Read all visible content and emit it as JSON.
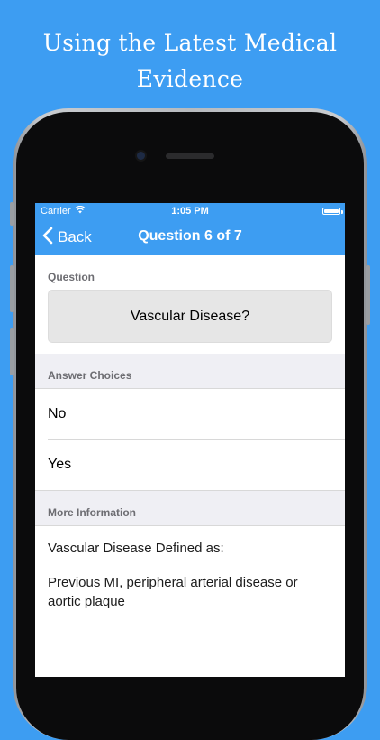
{
  "promo": {
    "headline_line1": "Using the Latest Medical",
    "headline_line2": "Evidence"
  },
  "status_bar": {
    "carrier": "Carrier",
    "time": "1:05 PM",
    "wifi_icon": "wifi-icon",
    "battery_icon": "battery-icon"
  },
  "nav": {
    "back_label": "Back",
    "back_icon": "chevron-left-icon",
    "title": "Question 6 of 7"
  },
  "question": {
    "header": "Question",
    "text": "Vascular Disease?"
  },
  "answers": {
    "header": "Answer Choices",
    "choices": [
      "No",
      "Yes"
    ]
  },
  "more_info": {
    "header": "More Information",
    "lines": [
      "Vascular Disease Defined as:",
      "Previous MI, peripheral arterial disease or aortic plaque"
    ]
  },
  "colors": {
    "accent": "#3d9df2",
    "grouped_background": "#efeff4",
    "section_header_text": "#6d6d72"
  }
}
